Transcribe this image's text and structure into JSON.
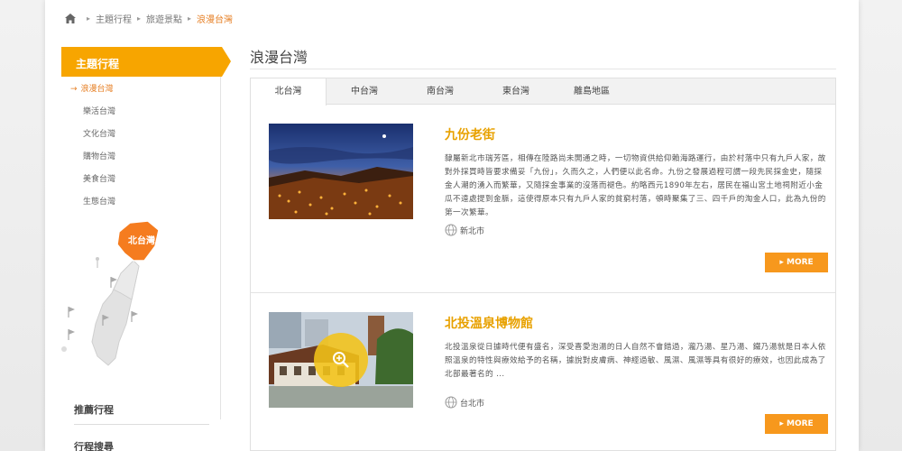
{
  "breadcrumb": {
    "items": [
      "主題行程",
      "旅遊景點"
    ],
    "current": "浪漫台灣"
  },
  "sidebar": {
    "heading": "主題行程",
    "items": [
      {
        "label": "浪漫台灣",
        "active": true
      },
      {
        "label": "樂活台灣"
      },
      {
        "label": "文化台灣"
      },
      {
        "label": "購物台灣"
      },
      {
        "label": "美食台灣"
      },
      {
        "label": "生態台灣"
      }
    ],
    "map_label": "北台灣",
    "bottom": [
      "推薦行程",
      "行程搜尋"
    ]
  },
  "main": {
    "title": "浪漫台灣",
    "tabs": [
      "北台灣",
      "中台灣",
      "南台灣",
      "東台灣",
      "離島地區"
    ],
    "active_tab": 0
  },
  "attractions": [
    {
      "title": "九份老街",
      "desc": "隸屬新北市瑞芳區，相傳在陸路尚未開通之時，一切物資供給仰賴海路運行，由於村落中只有九戶人家，故對外採買時皆要求備妥「九份」，久而久之，人們便以此名命。九份之發展過程可謂一段先民採金史，隨採金人潮的湧入而繁華，又隨採金事業的沒落而褪色。約略西元1890年左右，居民在福山宮土地祠附近小金瓜不遠處提到金脈，這使得原本只有九戶人家的貧窮村落，頓時聚集了三、四千戶的淘金人口，此為九份的第一次繁華。",
      "location": "新北市",
      "more": "MORE"
    },
    {
      "title": "北投溫泉博物館",
      "desc": "北投溫泉從日據時代便有盛名，深受喜愛泡湯的日人自然不會錯過，瀧乃湯、星乃湯、鐵乃湯就是日本人依照溫泉的特性與療效給予的名稱，據說對皮膚病、神經過敏、風濕、風濕等具有很好的療效，也因此成為了北部最著名的 ...",
      "location": "台北市",
      "more": "MORE"
    }
  ],
  "colors": {
    "accent": "#f7a500",
    "more_button": "#f7981d",
    "title": "#e8a100"
  }
}
